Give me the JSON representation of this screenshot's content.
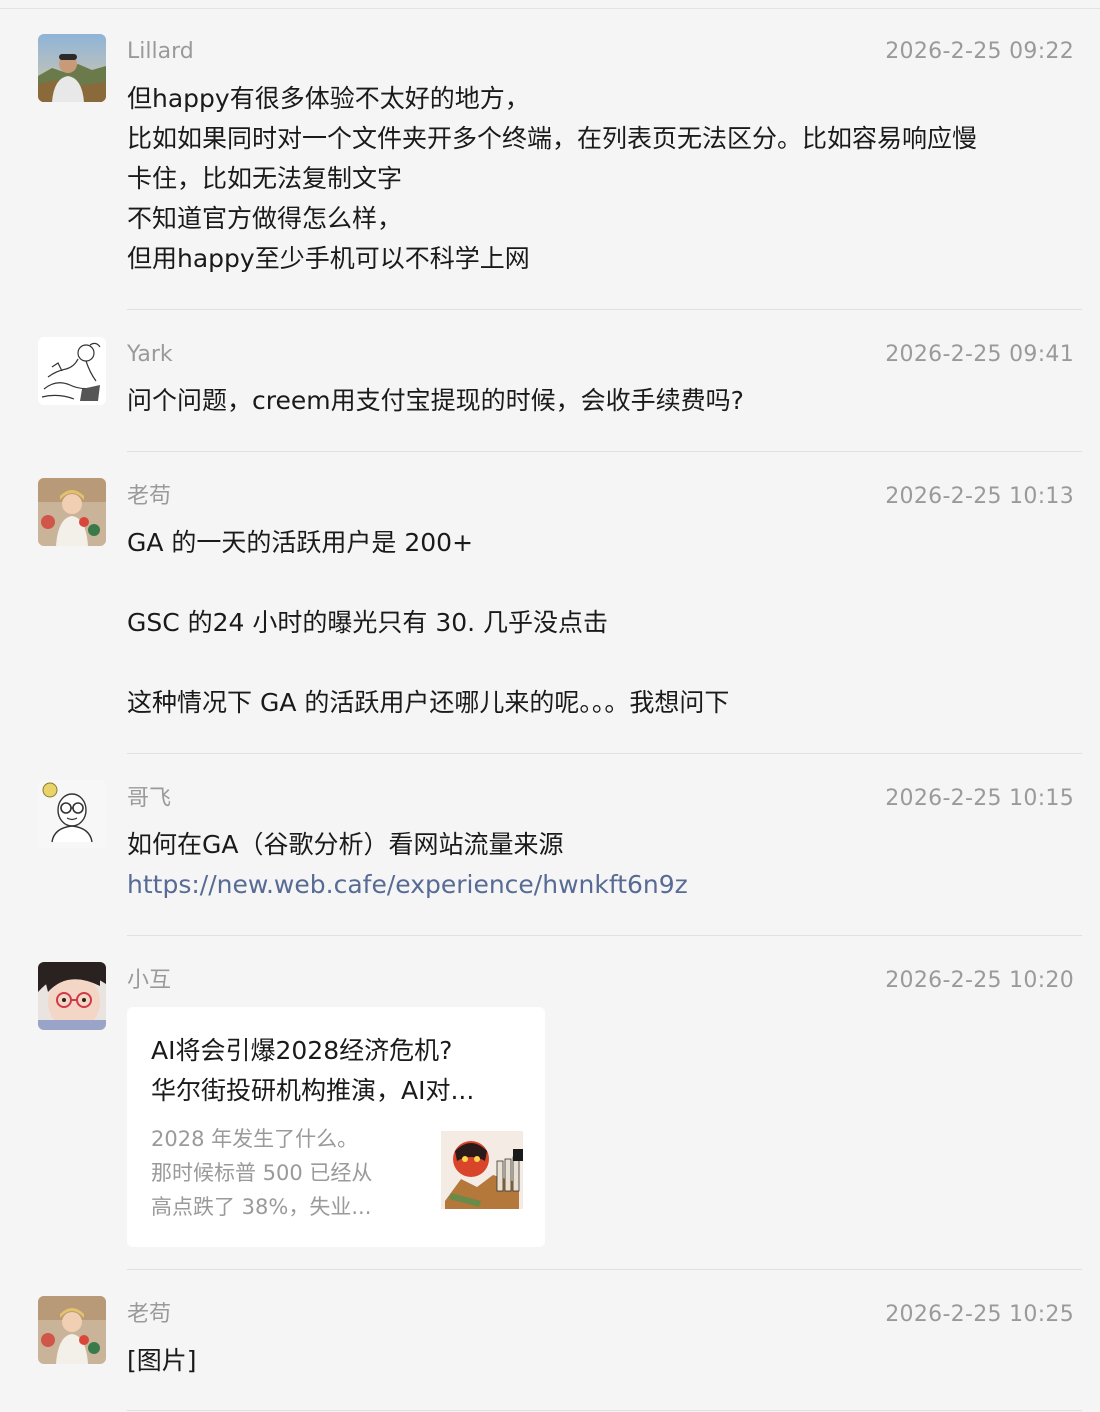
{
  "messages": [
    {
      "sender": "Lillard",
      "time": "2026-2-25 09:22",
      "avatar": "person-photo-avatar",
      "lines": [
        "但happy有很多体验不太好的地方，",
        "比如如果同时对一个文件夹开多个终端，在列表页无法区分。比如容易响应慢",
        "卡住，比如无法复制文字",
        "不知道官方做得怎么样，",
        "但用happy至少手机可以不科学上网"
      ]
    },
    {
      "sender": "Yark",
      "time": "2026-2-25 09:41",
      "avatar": "sketch-drawing-avatar",
      "lines": [
        "问个问题，creem用支付宝提现的时候，会收手续费吗?"
      ]
    },
    {
      "sender": "老苟",
      "time": "2026-2-25 10:13",
      "avatar": "child-photo-avatar",
      "lines": [
        "GA 的一天的活跃用户是 200+",
        "",
        "GSC 的24 小时的曝光只有 30. 几乎没点击",
        "",
        "这种情况下 GA 的活跃用户还哪儿来的呢。。。我想问下"
      ]
    },
    {
      "sender": "哥飞",
      "time": "2026-2-25 10:15",
      "avatar": "cartoon-glasses-avatar",
      "lines": [
        "如何在GA（谷歌分析）看网站流量来源"
      ],
      "link": "https://new.web.cafe/experience/hwnkft6n9z"
    },
    {
      "sender": "小互",
      "time": "2026-2-25 10:20",
      "avatar": "girl-glasses-avatar",
      "card": {
        "title_lines": [
          "AI将会引爆2028经济危机?",
          "华尔街投研机构推演，AI对..."
        ],
        "desc_lines": [
          "2028 年发生了什么。",
          "那时候标普 500 已经从",
          "高点跌了 38%，失业..."
        ],
        "thumb": "article-thumbnail-image"
      }
    },
    {
      "sender": "老苟",
      "time": "2026-2-25 10:25",
      "avatar": "child-photo-avatar",
      "lines": [
        "[图片]"
      ]
    }
  ],
  "colors": {
    "background": "#f5f5f5",
    "meta_text": "#9a9a9a",
    "link": "#576b95",
    "card_bg": "#ffffff"
  }
}
